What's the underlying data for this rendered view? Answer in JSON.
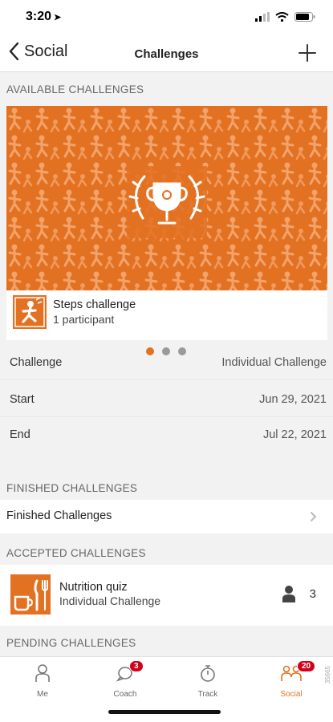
{
  "status": {
    "time": "3:20",
    "location_icon": "location-arrow-icon"
  },
  "nav": {
    "back_label": "Social",
    "title": "Challenges"
  },
  "sections": {
    "available": "AVAILABLE CHALLENGES",
    "finished": "FINISHED CHALLENGES",
    "accepted": "ACCEPTED CHALLENGES",
    "pending": "PENDING CHALLENGES"
  },
  "featured": {
    "name": "Steps challenge",
    "participants": "1 participant",
    "details": [
      {
        "label": "Challenge",
        "value": "Individual Challenge"
      },
      {
        "label": "Start",
        "value": "Jun 29, 2021"
      },
      {
        "label": "End",
        "value": "Jul 22, 2021"
      }
    ]
  },
  "finished_row": {
    "label": "Finished Challenges"
  },
  "accepted_item": {
    "name": "Nutrition quiz",
    "type": "Individual Challenge",
    "count": "3"
  },
  "tabs": [
    {
      "label": "Me",
      "icon": "person-icon"
    },
    {
      "label": "Coach",
      "icon": "chat-icon",
      "badge": "3"
    },
    {
      "label": "Track",
      "icon": "stopwatch-icon"
    },
    {
      "label": "Social",
      "icon": "people-icon",
      "badge": "20"
    }
  ],
  "build": "35665",
  "colors": {
    "accent": "#e37122",
    "badge": "#d0021b",
    "background": "#f2f2f2"
  }
}
